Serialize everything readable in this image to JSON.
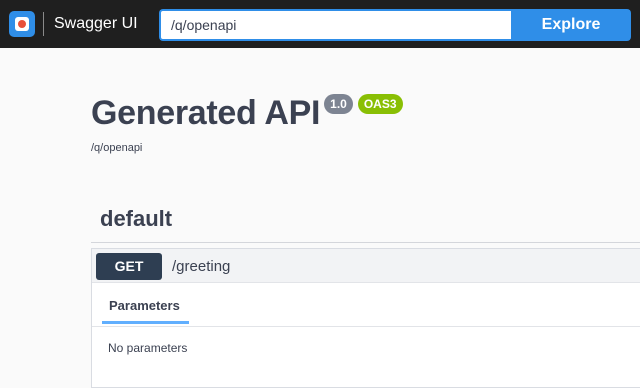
{
  "topbar": {
    "brand": "Swagger UI",
    "url_value": "/q/openapi",
    "explore_label": "Explore",
    "colors": {
      "background": "#1f1f1f",
      "accent": "#2f8ee8"
    }
  },
  "info": {
    "title": "Generated API",
    "version": "1.0",
    "oas_badge": "OAS3",
    "url": "/q/openapi"
  },
  "tag": {
    "name": "default"
  },
  "operation": {
    "method": "GET",
    "path": "/greeting",
    "parameters_tab": "Parameters",
    "no_params_text": "No parameters",
    "method_color": "#2e3e52"
  }
}
